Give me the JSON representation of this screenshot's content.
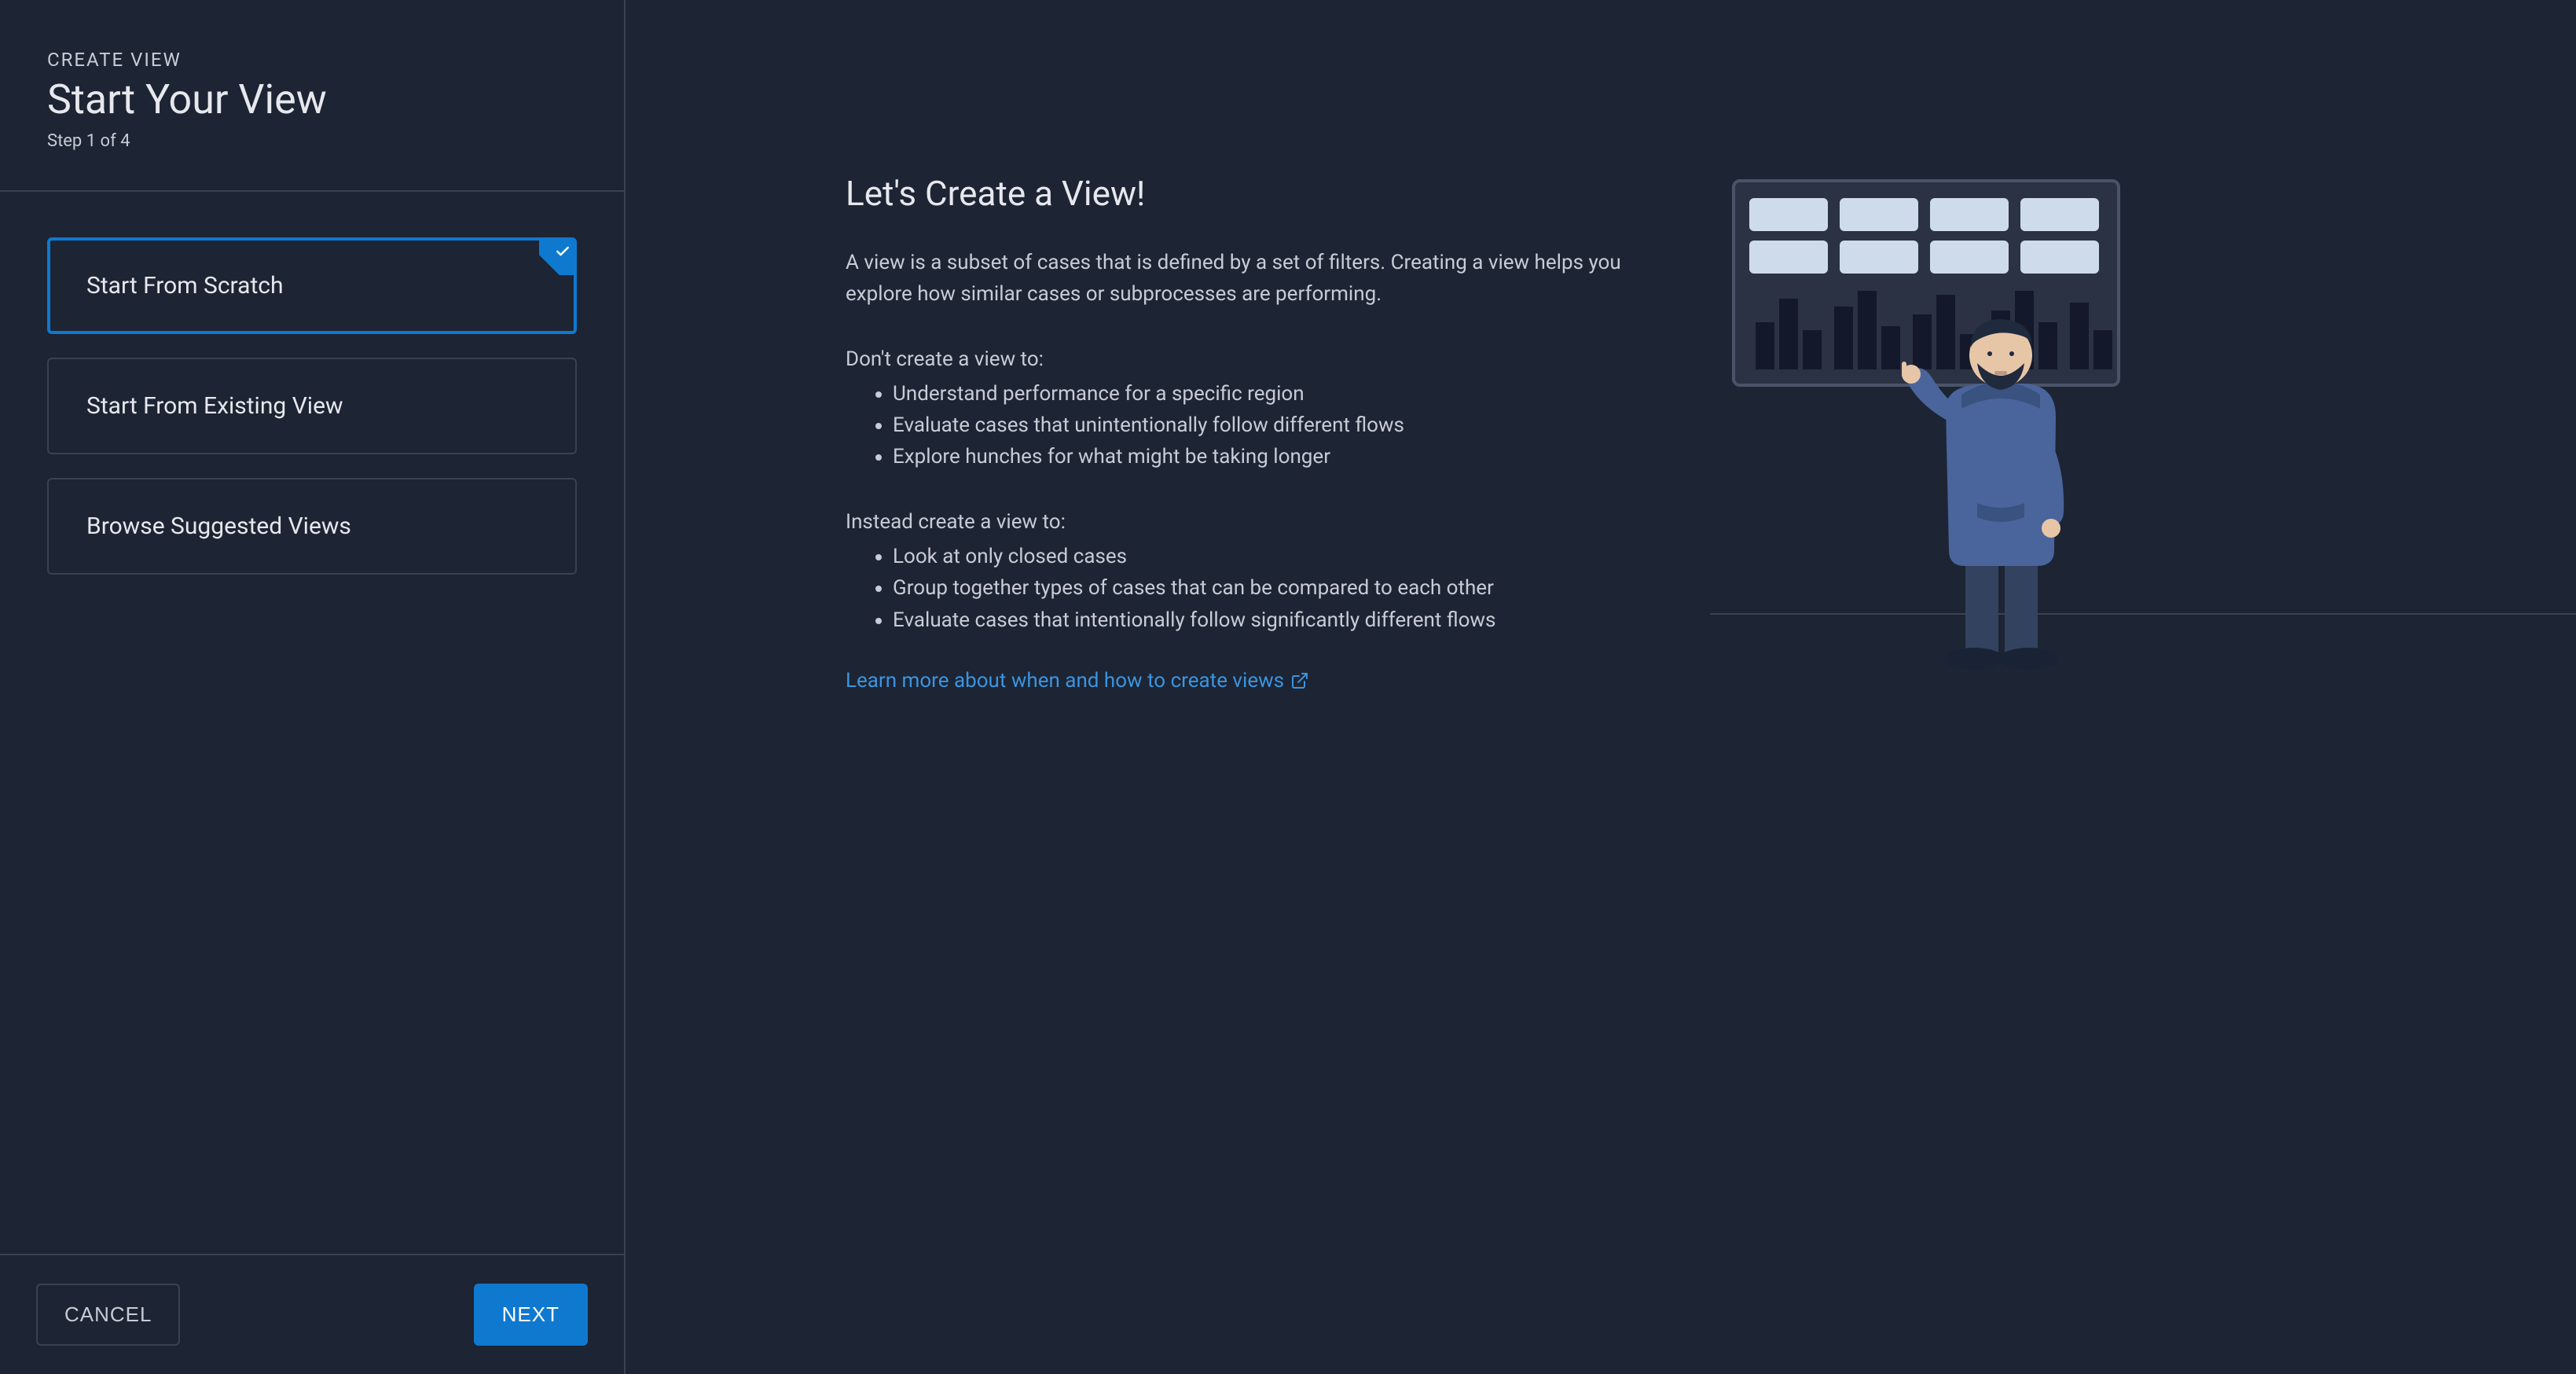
{
  "sidebar": {
    "overline": "CREATE VIEW",
    "title": "Start Your View",
    "step": "Step 1 of 4",
    "options": [
      {
        "label": "Start From Scratch",
        "selected": true
      },
      {
        "label": "Start From Existing View",
        "selected": false
      },
      {
        "label": "Browse Suggested Views",
        "selected": false
      }
    ],
    "cancel": "CANCEL",
    "next": "NEXT"
  },
  "main": {
    "heading": "Let's Create a View!",
    "intro": "A view is a subset of cases that is defined by a set of filters. Creating a view helps you explore how similar cases or subprocesses are performing.",
    "dont_lead": "Don't create a view to:",
    "dont_items": [
      "Understand performance for a specific region",
      "Evaluate cases that unintentionally follow different flows",
      "Explore hunches for what might be taking longer"
    ],
    "do_lead": "Instead create a view to:",
    "do_items": [
      "Look at only closed cases",
      "Group together types of cases that can be compared to each other",
      "Evaluate cases that intentionally follow significantly different flows"
    ],
    "learn_link": "Learn more about when and how to create views"
  }
}
